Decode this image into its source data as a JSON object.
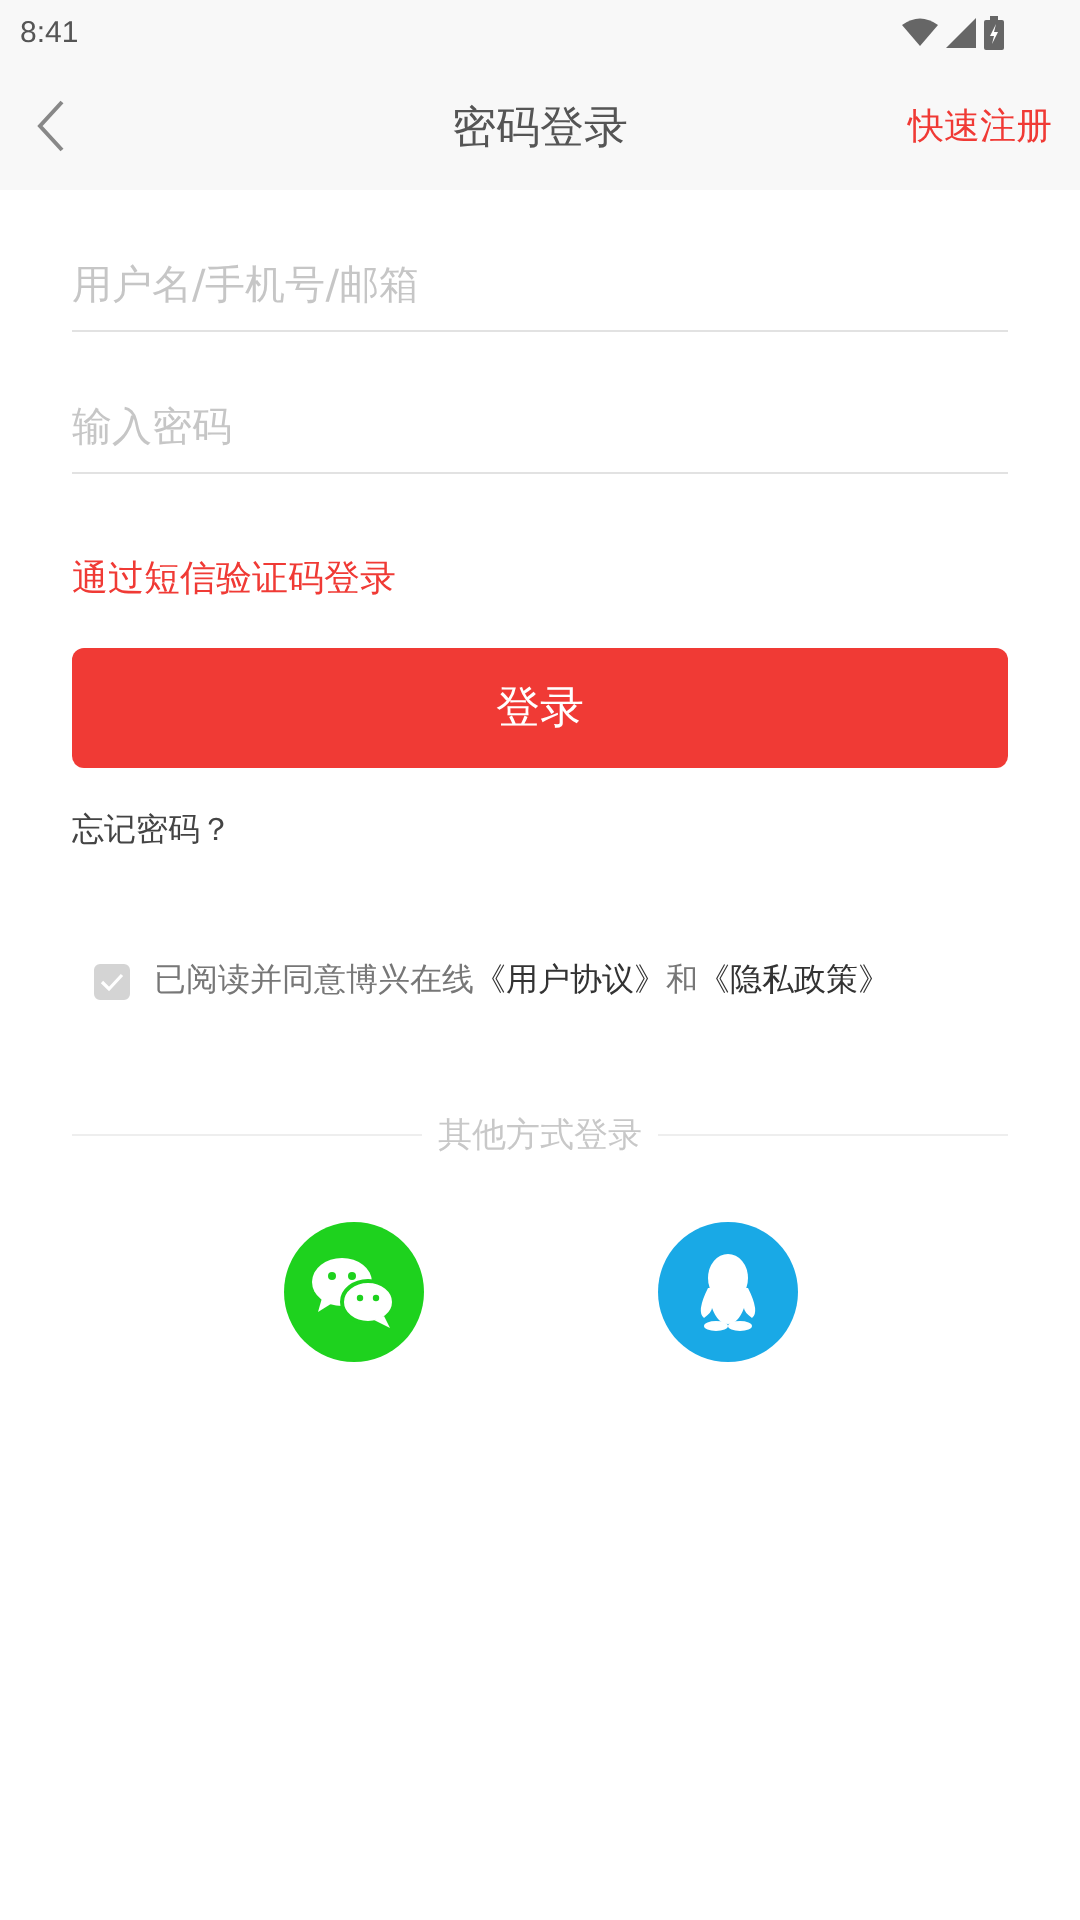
{
  "status_bar": {
    "time": "8:41"
  },
  "nav": {
    "title": "密码登录",
    "action": "快速注册"
  },
  "fields": [
    {
      "placeholder": "用户名/手机号/邮箱"
    },
    {
      "placeholder": "输入密码"
    }
  ],
  "sms_link": "通过短信验证码登录",
  "login_button": "登录",
  "forgot_link": "忘记密码？",
  "agreement": {
    "checked": true,
    "prefix": "已阅读并同意博兴在线",
    "link1": "《用户协议》",
    "middle": "和",
    "link2": "《隐私政策》"
  },
  "other_login": {
    "title": "其他方式登录",
    "buttons": [
      {
        "kind": "wechat",
        "color": "#1ed21e"
      },
      {
        "kind": "qq",
        "color": "#19a9e6"
      }
    ]
  }
}
